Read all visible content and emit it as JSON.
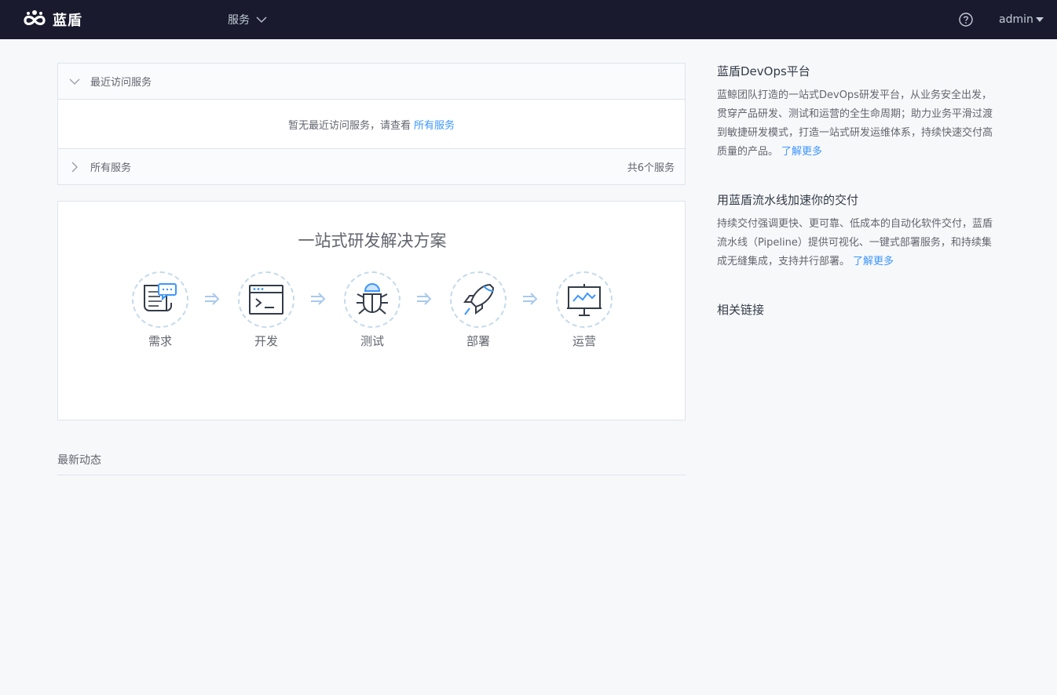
{
  "header": {
    "logo_text": "蓝盾",
    "nav_service": "服务",
    "user": "admin"
  },
  "recent": {
    "title": "最近访问服务",
    "empty_text": "暂无最近访问服务，请查看",
    "empty_link": "所有服务"
  },
  "all_services": {
    "title": "所有服务",
    "count": "共6个服务"
  },
  "solution": {
    "title": "一站式研发解决方案",
    "steps": [
      {
        "label": "需求",
        "icon": "requirement-doc-icon"
      },
      {
        "label": "开发",
        "icon": "terminal-icon"
      },
      {
        "label": "测试",
        "icon": "bug-icon"
      },
      {
        "label": "部署",
        "icon": "rocket-icon"
      },
      {
        "label": "运营",
        "icon": "presentation-chart-icon"
      }
    ]
  },
  "activity": {
    "title": "最新动态"
  },
  "sidebar": {
    "platform": {
      "title": "蓝盾DevOps平台",
      "body": "蓝鲸团队打造的一站式DevOps研发平台，从业务安全出发，贯穿产品研发、测试和运营的全生命周期；助力业务平滑过渡到敏捷研发模式，打造一站式研发运维体系，持续快速交付高质量的产品。",
      "link": "了解更多"
    },
    "pipeline": {
      "title": "用蓝盾流水线加速你的交付",
      "body": "持续交付强调更快、更可靠、低成本的自动化软件交付，蓝盾流水线（Pipeline）提供可视化、一键式部署服务，和持续集成无缝集成，支持并行部署。",
      "link": "了解更多"
    },
    "links": {
      "title": "相关链接"
    }
  },
  "colors": {
    "topbar": "#1a1a2e",
    "accent": "#3c96ff",
    "icon_stroke": "#333c48",
    "icon_accent": "#3c96ff"
  }
}
